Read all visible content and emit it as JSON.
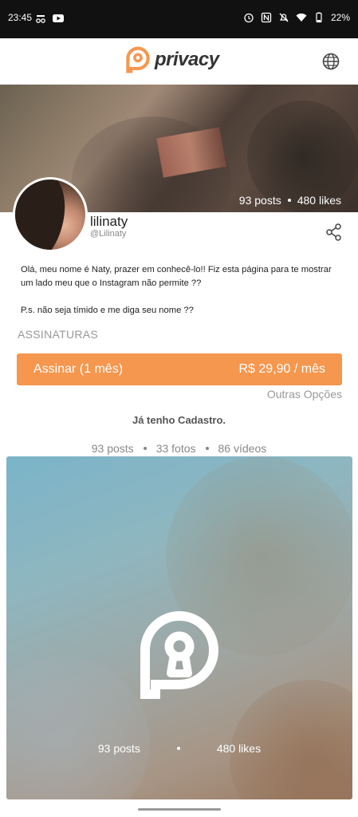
{
  "status_bar": {
    "time": "23:45",
    "battery": "22%",
    "icons": [
      "incognito-icon",
      "youtube-icon",
      "alarm-icon",
      "nfc-icon",
      "mute-icon",
      "wifi-icon",
      "battery-icon"
    ]
  },
  "header": {
    "logo_text": "privacy",
    "brand_color": "#f5974e",
    "globe_icon": "globe-icon"
  },
  "cover": {
    "posts": "93 posts",
    "likes": "480 likes"
  },
  "profile": {
    "name": "lilinaty",
    "handle": "@Lilinaty",
    "bio_line1": "Olá, meu nome é Naty, prazer em conhecê-lo!! Fiz esta página para te mostrar um lado meu que o Instagram não permite ??",
    "bio_line2": "P.s. não seja tímido e me diga seu nome ??"
  },
  "subscriptions": {
    "title": "ASSINATURAS",
    "button_label": "Assinar (1 mês)",
    "button_price": "R$ 29,90 / mês",
    "other_options": "Outras Opções",
    "already_registered": "Já tenho Cadastro."
  },
  "counts": {
    "posts": "93 posts",
    "photos": "33 fotos",
    "videos": "86 vídeos"
  },
  "media_card": {
    "posts": "93 posts",
    "likes": "480 likes"
  }
}
